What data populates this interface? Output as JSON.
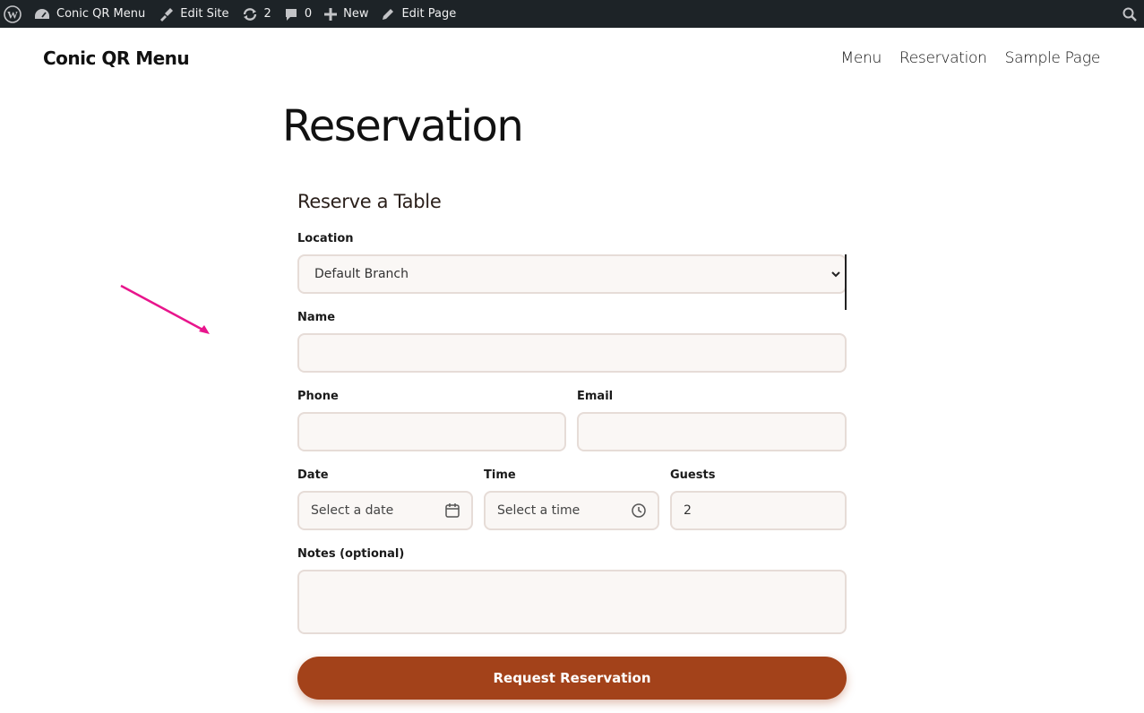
{
  "admin_bar": {
    "site_name": "Conic QR Menu",
    "edit_site": "Edit Site",
    "updates_count": "2",
    "comments_count": "0",
    "new_label": "New",
    "edit_page": "Edit Page"
  },
  "header": {
    "site_title": "Conic QR Menu",
    "nav": [
      "Menu",
      "Reservation",
      "Sample Page"
    ]
  },
  "page": {
    "title": "Reservation"
  },
  "form": {
    "heading": "Reserve a Table",
    "location_label": "Location",
    "location_value": "Default Branch",
    "name_label": "Name",
    "name_value": "",
    "phone_label": "Phone",
    "phone_value": "",
    "email_label": "Email",
    "email_value": "",
    "date_label": "Date",
    "date_placeholder": "Select a date",
    "time_label": "Time",
    "time_placeholder": "Select a time",
    "guests_label": "Guests",
    "guests_value": "2",
    "notes_label": "Notes (optional)",
    "notes_value": "",
    "submit_label": "Request Reservation"
  },
  "colors": {
    "admin_bar_bg": "#1d2327",
    "button_bg": "#a3421a",
    "field_bg": "#faf7f5",
    "field_border": "#e6dcd7",
    "arrow": "#e8158c"
  }
}
